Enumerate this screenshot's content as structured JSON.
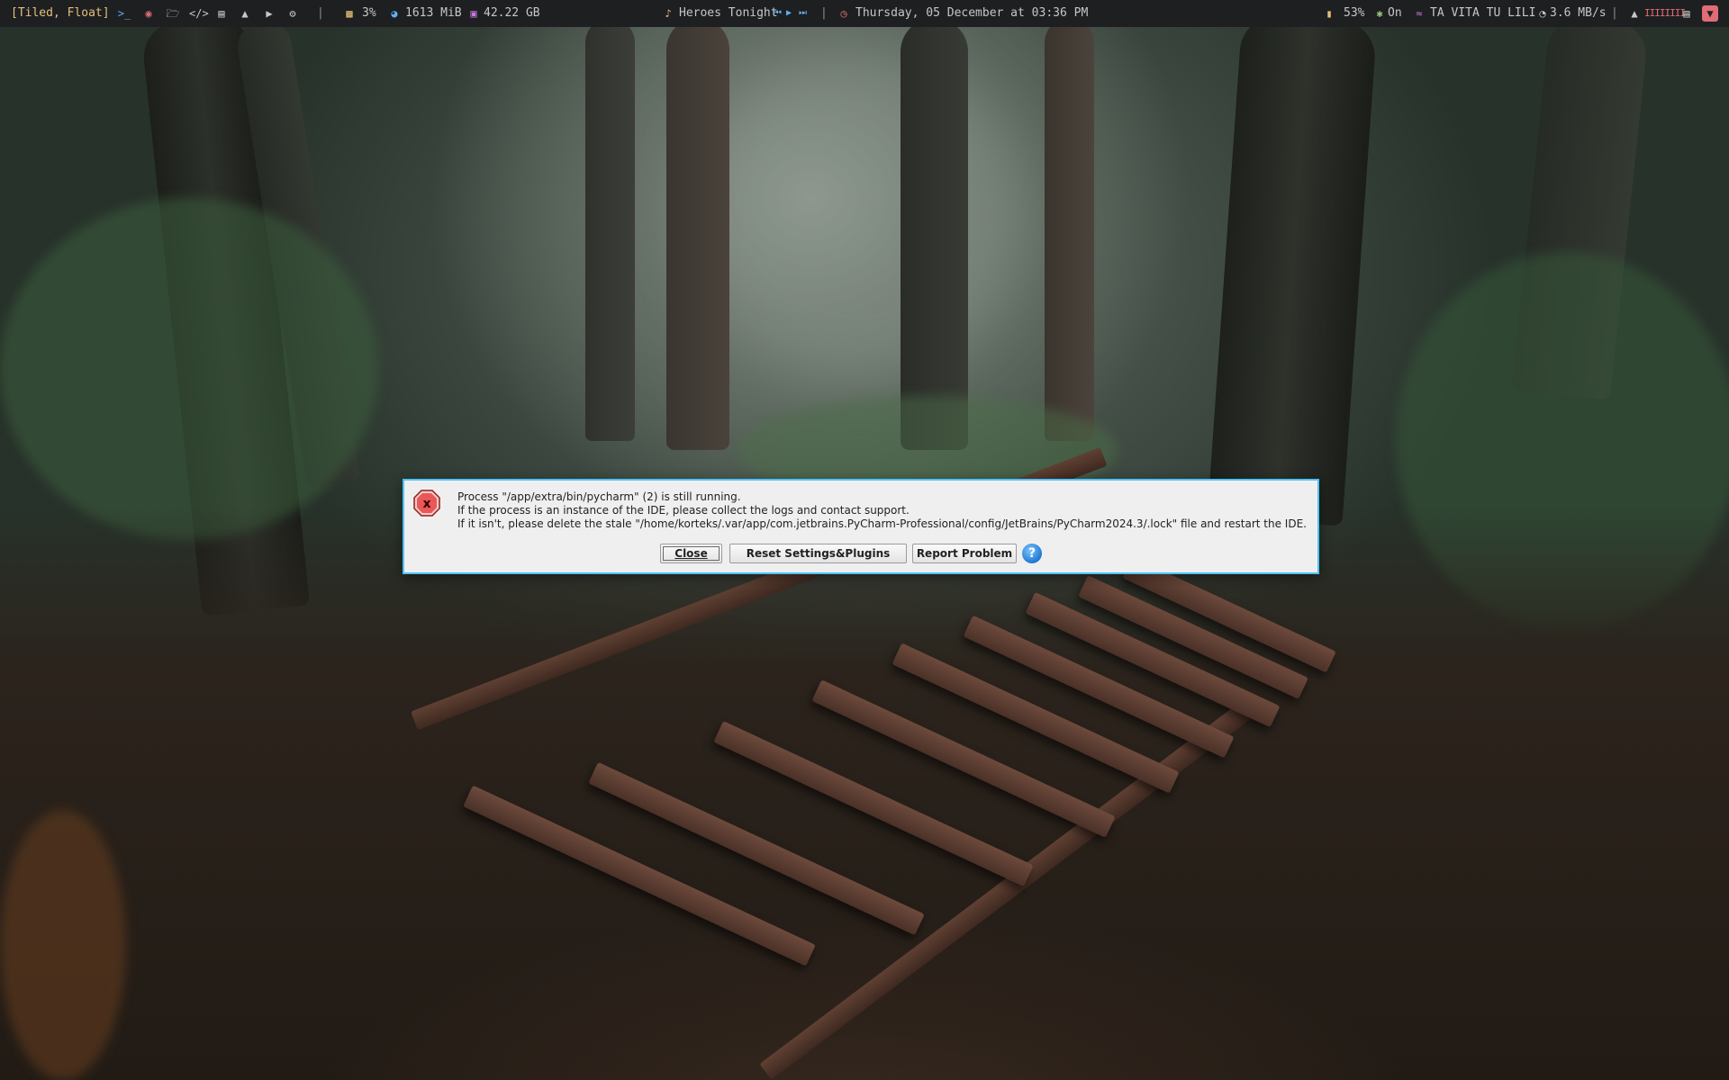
{
  "topbar": {
    "layout_mode": "[Tiled, Float]",
    "launcher_icons": [
      "terminal-icon",
      "firefox-icon",
      "folder-icon",
      "code-icon",
      "book-icon",
      "chat-icon",
      "youtube-icon",
      "settings-icon"
    ],
    "separator": "|",
    "cpu": "3%",
    "memory": "1613 MiB",
    "disk": "42.22 GB",
    "music_title": "Heroes Tonight",
    "media_controls": {
      "prev": "⏮",
      "play": "▶",
      "next": "⏭"
    },
    "datetime": "Thursday, 05 December at 03:36 PM",
    "battery": "53%",
    "bluetooth": "On",
    "wifi_ssid": "TA VITA TU LILI",
    "net_speed": "3.6 MB/s",
    "volume_bars": "IIIIIIII"
  },
  "dialog": {
    "line1": "Process \"/app/extra/bin/pycharm\" (2) is still running.",
    "line2": "If the process is an instance of the IDE, please collect the logs and contact support.",
    "line3": "If it isn't, please delete the stale \"/home/korteks/.var/app/com.jetbrains.PyCharm-Professional/config/JetBrains/PyCharm2024.3/.lock\" file and restart the IDE.",
    "close_label": "Close",
    "reset_label": "Reset Settings&Plugins",
    "report_label": "Report Problem",
    "help_label": "?"
  },
  "colors": {
    "bar_bg": "#1d1f21",
    "accent_yellow": "#e5c07b",
    "dialog_border": "#4fc3f7",
    "error_red": "#d9363e"
  }
}
